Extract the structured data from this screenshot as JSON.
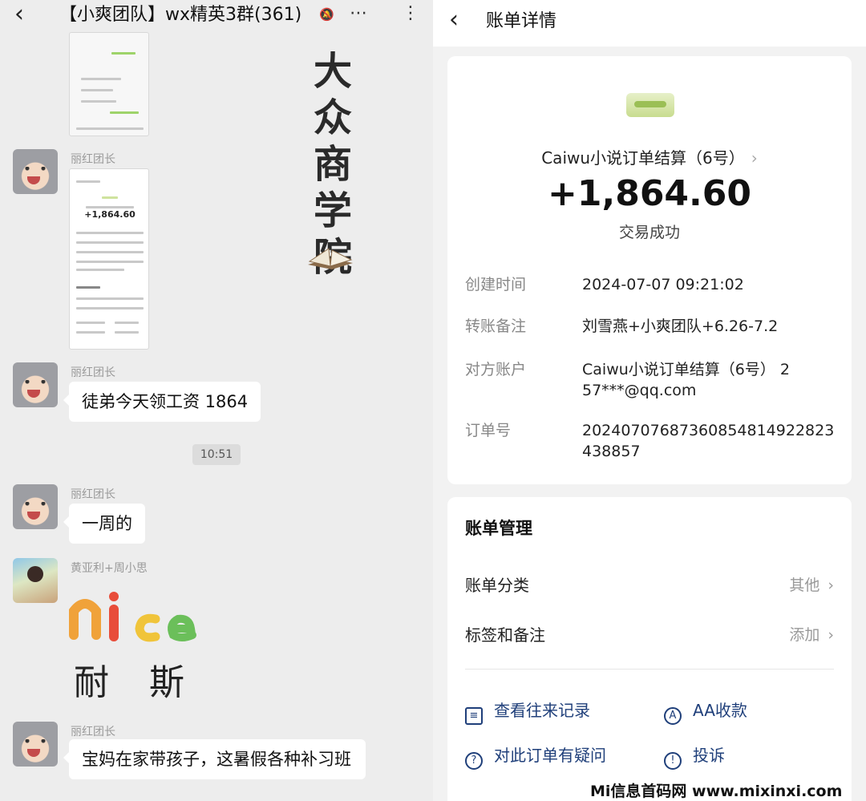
{
  "chat": {
    "title": "【小爽团队】wx精英3群(361)",
    "messages": [
      {
        "sender": "丽红团长",
        "type": "image"
      },
      {
        "sender": "丽红团长",
        "text": "徒弟今天领工资 1864"
      },
      {
        "time": "10:51"
      },
      {
        "sender": "丽红团长",
        "text": "一周的"
      },
      {
        "sender": "黄亚利+周小思",
        "type": "sticker",
        "sticker_text": "耐 斯",
        "sticker_letters": "nice"
      },
      {
        "sender": "丽红团长",
        "text": "宝妈在家带孩子，这暑假各种补习班"
      }
    ],
    "watermark": "大众商学院",
    "thumb": {
      "amount": "+1,864.60"
    }
  },
  "bill": {
    "title": "账单详情",
    "merchant": "Caiwu小说订单结算（6号）",
    "amount": "+1,864.60",
    "status": "交易成功",
    "details": [
      {
        "label": "创建时间",
        "value": "2024-07-07 09:21:02"
      },
      {
        "label": "转账备注",
        "value": "刘雪燕+小爽团队+6.26-7.2"
      },
      {
        "label": "对方账户",
        "value": "Caiwu小说订单结算（6号） 257***@qq.com"
      },
      {
        "label": "订单号",
        "value": "20240707687360854814922823438857"
      }
    ],
    "management": {
      "title": "账单管理",
      "category_label": "账单分类",
      "category_value": "其他",
      "tag_label": "标签和备注",
      "tag_value": "添加"
    },
    "actions": [
      "查看往来记录",
      "AA收款",
      "对此订单有疑问",
      "投诉"
    ]
  },
  "footer_watermark": "Mi信息首码网 www.mixinxi.com"
}
